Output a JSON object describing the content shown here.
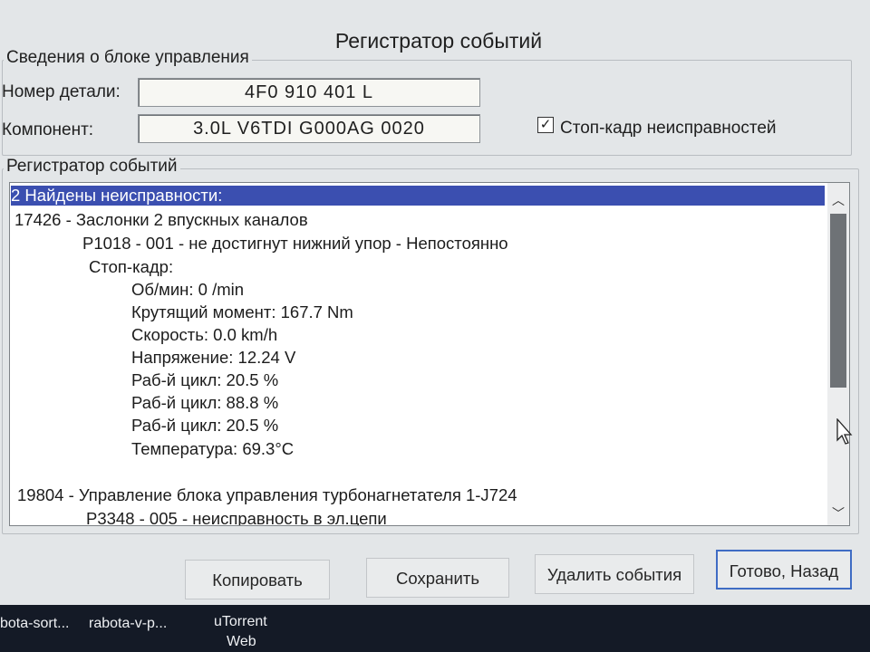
{
  "window": {
    "title": "Регистратор событий"
  },
  "info_group": {
    "legend": "Сведения о блоке управления",
    "part_number_label": "Номер детали:",
    "part_number_value": "4F0 910 401 L",
    "component_label": "Компонент:",
    "component_value": "3.0L V6TDI  G000AG  0020",
    "freeze_frame_checkbox": {
      "label": "Стоп-кадр неисправностей",
      "checked": true
    }
  },
  "log_group": {
    "legend": "Регистратор событий",
    "lines": [
      "2 Найдены неисправности:",
      "17426 - Заслонки 2 впускных каналов",
      "P1018 - 001 - не достигнут нижний упор - Непостоянно",
      "Стоп-кадр:",
      "Об/мин: 0 /min",
      "Крутящий момент: 167.7 Nm",
      "Скорость: 0.0 km/h",
      "Напряжение: 12.24 V",
      "Раб-й цикл: 20.5 %",
      "Раб-й цикл: 88.8 %",
      "Раб-й цикл: 20.5 %",
      "Температура: 69.3°C",
      "19804 - Управление блока управления турбонагнетателя 1-J724",
      "P3348 - 005 - неисправность в эл.цепи"
    ]
  },
  "buttons": {
    "copy": "Копировать",
    "save": "Сохранить",
    "delete": "Удалить события",
    "done": "Готово, Назад"
  },
  "taskbar": {
    "items": [
      "bota-sort...",
      "rabota-v-p...",
      "uTorrent",
      "Web"
    ]
  },
  "colors": {
    "selection": "#3b4fb0",
    "window_bg": "#e3e6e8",
    "taskbar_bg": "#141a26"
  }
}
